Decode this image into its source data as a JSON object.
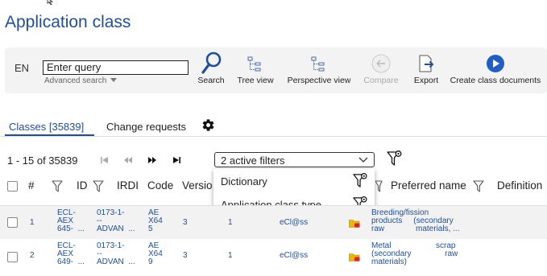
{
  "page": {
    "title": "Application class"
  },
  "colors": {
    "accent": "#1f4e9c",
    "toolbar_bg": "#f3f3f3",
    "row_alt": "#f2f2f2"
  },
  "toolbar": {
    "language": "EN",
    "query_value": "Enter query",
    "advanced_search": "Advanced search",
    "tools": [
      {
        "label": "Search",
        "icon": "magnifier-icon",
        "enabled": true
      },
      {
        "label": "Tree view",
        "icon": "tree-view-icon",
        "enabled": true
      },
      {
        "label": "Perspective view",
        "icon": "perspective-tree-icon",
        "enabled": true
      },
      {
        "label": "Compare",
        "icon": "compare-icon",
        "enabled": false
      },
      {
        "label": "Export",
        "icon": "export-icon",
        "enabled": true
      },
      {
        "label": "Create class documents",
        "icon": "play-circle-icon",
        "enabled": true
      }
    ]
  },
  "tabs": [
    {
      "label": "Classes [35839]",
      "active": true
    },
    {
      "label": "Change requests",
      "active": false
    }
  ],
  "pagination": {
    "range_text": "1 - 15 of 35839"
  },
  "filters": {
    "selected": "2 active filters",
    "options": [
      "Dictionary",
      "Application class type"
    ]
  },
  "table": {
    "headers": [
      "#",
      "ID",
      "IRDI",
      "Code",
      "Versio",
      "Preferred name",
      "Definition"
    ],
    "rows": [
      {
        "num": "1",
        "id": "ECL-\nAEX\n645-  ...",
        "irdi": "0173-1-\n--\nADVAN  ...",
        "code": "AE\nX64\n5",
        "version": "3",
        "revision": "1",
        "source": "eCl@ss",
        "name": "Breeding/fission\nproducts     (secondary\nraw              materials, ..."
      },
      {
        "num": "2",
        "id": "ECL-\nAEX\n649-  ...",
        "irdi": "0173-1-\n--\nADVAN  ...",
        "code": "AE\nX64\n9",
        "version": "3",
        "revision": "1",
        "source": "eCl@ss",
        "name": "Metal                    scrap\n(secondary               raw\nmaterials)"
      }
    ]
  }
}
